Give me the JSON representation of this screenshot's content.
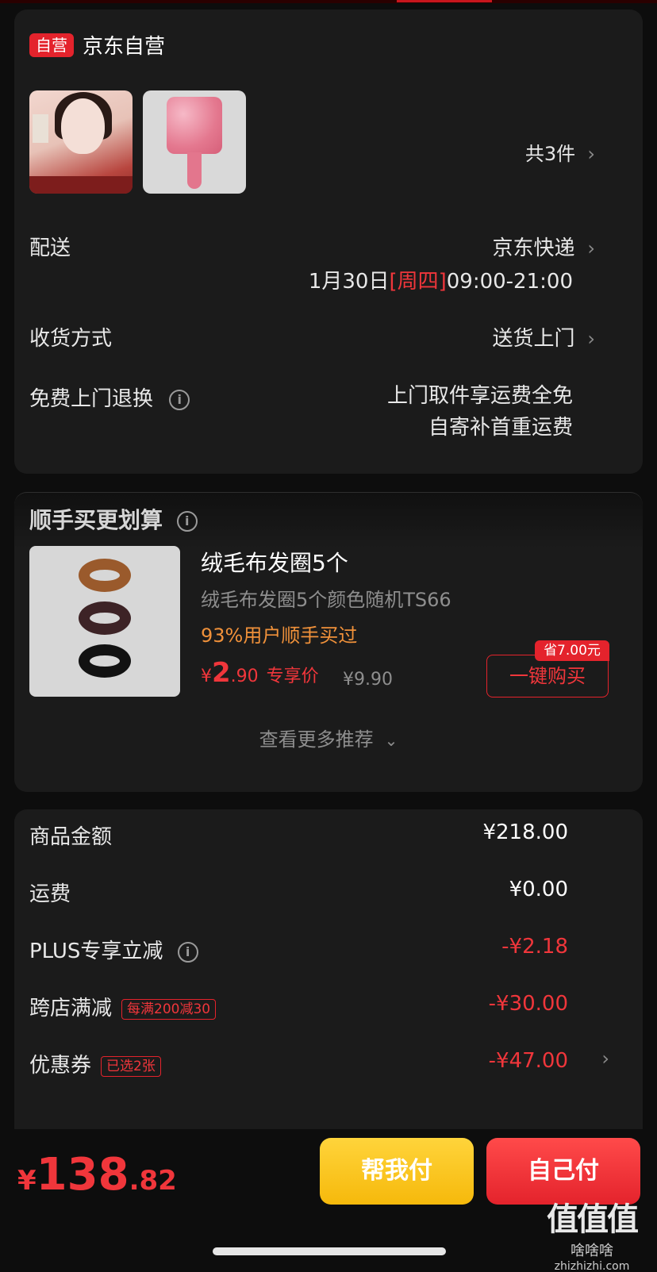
{
  "shop": {
    "badge": "自营",
    "name": "京东自营"
  },
  "items": {
    "count_text": "共3件"
  },
  "delivery": {
    "label": "配送",
    "carrier": "京东快递",
    "date": "1月30日",
    "weekday": "[周四]",
    "time": "09:00-21:00"
  },
  "receive": {
    "label": "收货方式",
    "value": "送货上门"
  },
  "returns": {
    "label": "免费上门退换",
    "line1": "上门取件享运费全免",
    "line2": "自寄补首重运费"
  },
  "recommend": {
    "title": "顺手买更划算",
    "product": {
      "name": "绒毛布发圈5个",
      "desc": "绒毛布发圈5个颜色随机TS66",
      "bought": "93%用户顺手买过",
      "price_yen": "¥",
      "price_int": "2",
      "price_dec": ".90",
      "price_label": "专享价",
      "orig_price": "¥9.90",
      "save_tag": "省7.00元",
      "buy_label": "一键购买"
    },
    "more": "查看更多推荐"
  },
  "summary": {
    "rows": [
      {
        "label": "商品金额",
        "value": "¥218.00"
      },
      {
        "label": "运费",
        "value": "¥0.00"
      },
      {
        "label": "PLUS专享立减",
        "value": "-¥2.18"
      },
      {
        "label": "跨店满减",
        "tag": "每满200减30",
        "value": "-¥30.00"
      },
      {
        "label": "优惠券",
        "tag": "已选2张",
        "value": "-¥47.00"
      }
    ]
  },
  "footer": {
    "price_yen": "¥",
    "price_int": "138",
    "price_dec": ".82",
    "help_label": "帮我付",
    "self_label": "自己付"
  },
  "watermark": {
    "big": "值值值",
    "mid": "啥啥啥",
    "site": "zhizhizhi.com"
  },
  "colors": {
    "accent": "#e4232c",
    "gold": "#f6b90b",
    "orange": "#f0913a"
  }
}
